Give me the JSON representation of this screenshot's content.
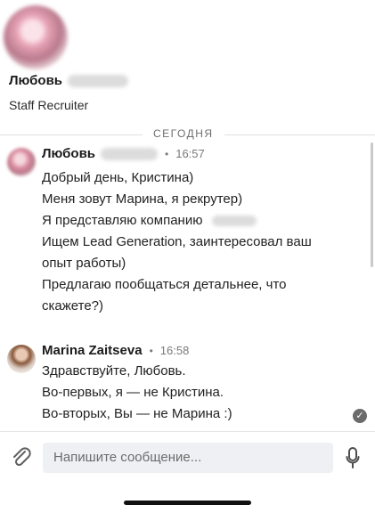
{
  "profile": {
    "name": "Любовь",
    "title": "Staff Recruiter"
  },
  "divider": {
    "label": "СЕГОДНЯ"
  },
  "messages": [
    {
      "sender": "Любовь",
      "time": "16:57",
      "lines": [
        "Добрый день, Кристина)",
        "Меня зовут Марина, я рекрутер)",
        "Я представляю компанию",
        "Ищем Lead Generation, заинтересовал ваш",
        "опыт работы)",
        "Предлагаю пообщаться детальнее, что",
        "скажете?)"
      ]
    },
    {
      "sender": "Marina Zaitseva",
      "time": "16:58",
      "lines": [
        "Здравствуйте, Любовь.",
        "Во-первых, я — не Кристина.",
        "Во-вторых, Вы — не Марина :)"
      ]
    }
  ],
  "composer": {
    "placeholder": "Напишите сообщение..."
  },
  "icons": {
    "attach": "paperclip-icon",
    "mic": "microphone-icon",
    "seen": "check-circle-icon"
  }
}
